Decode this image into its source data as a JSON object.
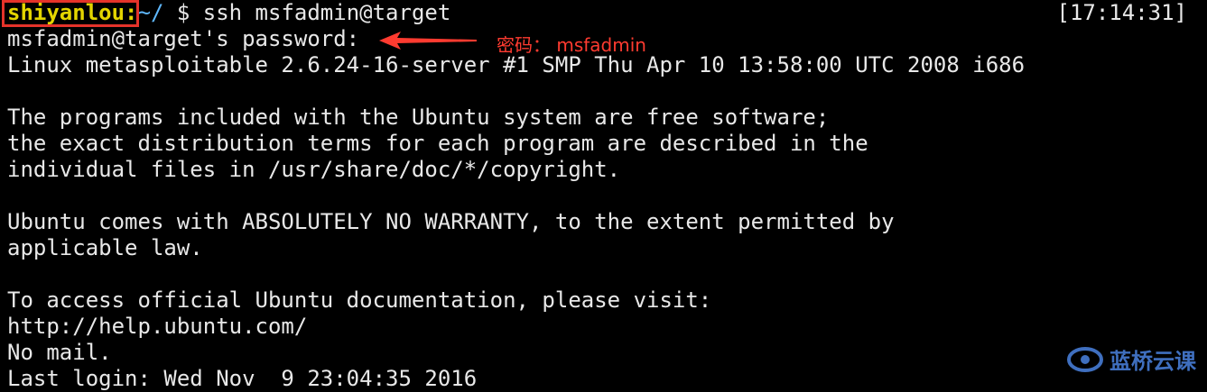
{
  "terminal": {
    "prompt_user": "shiyanlou:",
    "prompt_path": "~/",
    "command": " $ ssh msfadmin@target",
    "timestamp": "[17:14:31]",
    "lines": [
      "msfadmin@target's password:",
      "Linux metasploitable 2.6.24-16-server #1 SMP Thu Apr 10 13:58:00 UTC 2008 i686",
      "",
      "The programs included with the Ubuntu system are free software;",
      "the exact distribution terms for each program are described in the",
      "individual files in /usr/share/doc/*/copyright.",
      "",
      "Ubuntu comes with ABSOLUTELY NO WARRANTY, to the extent permitted by",
      "applicable law.",
      "",
      "To access official Ubuntu documentation, please visit:",
      "http://help.ubuntu.com/",
      "No mail.",
      "Last login: Wed Nov  9 23:04:35 2016"
    ]
  },
  "annotation": {
    "text": "密码： msfadmin",
    "color": "#ff3b30"
  },
  "watermark": {
    "text": "蓝桥云课",
    "icon": "lanqiao-logo-icon"
  },
  "colors": {
    "background": "#000000",
    "foreground": "#e8e8e8",
    "prompt_user": "#e4d500",
    "prompt_path": "#5fb8ff",
    "highlight_box": "#e5332a"
  }
}
